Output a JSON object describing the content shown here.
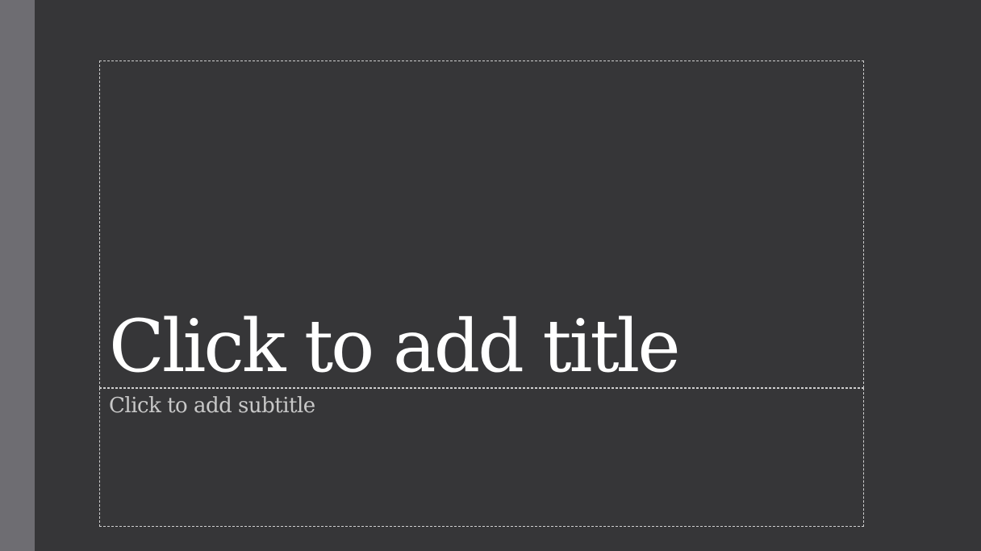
{
  "slide": {
    "title_placeholder": "Click to add title",
    "subtitle_placeholder": "Click to add subtitle"
  },
  "colors": {
    "background": "#363638",
    "left_bar": "#6e6d72",
    "title_text": "#ffffff",
    "subtitle_text": "#c8c8c8",
    "placeholder_border": "#cfcfcf"
  }
}
